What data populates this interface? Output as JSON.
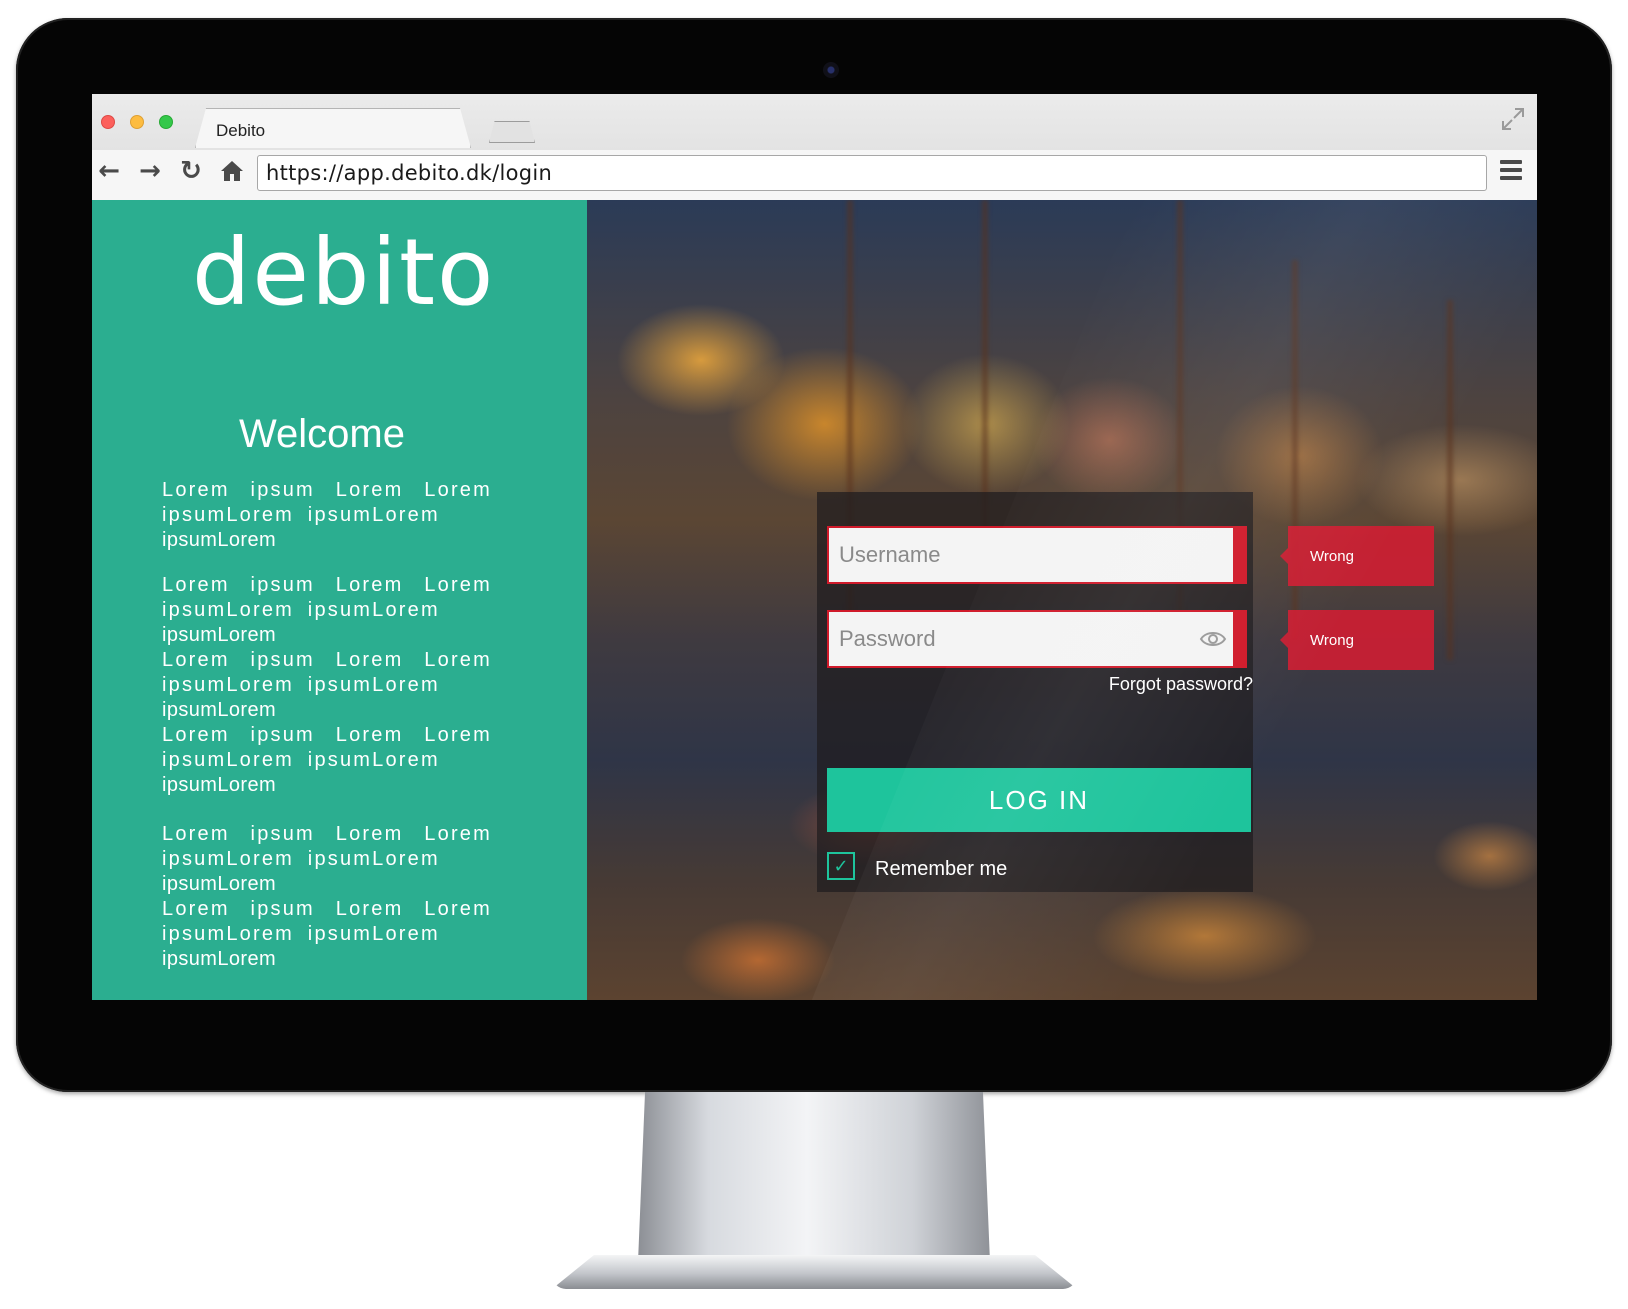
{
  "browser": {
    "tab_title": "Debito",
    "url": "https://app.debito.dk/login"
  },
  "left_panel": {
    "logo_text": "debito",
    "welcome": "Welcome",
    "paragraphs": [
      [
        "Lorem ipsum Lorem Lorem ipsumLorem ipsumLorem",
        "ipsumLorem"
      ],
      [
        "Lorem ipsum Lorem Lorem ipsumLorem ipsumLorem",
        "ipsumLorem"
      ],
      [
        "Lorem ipsum Lorem Lorem ipsumLorem ipsumLorem",
        "ipsumLorem"
      ],
      [
        "Lorem ipsum Lorem Lorem ipsumLorem ipsumLorem",
        "ipsumLorem"
      ],
      [
        "Lorem ipsum Lorem Lorem ipsumLorem ipsumLorem",
        "ipsumLorem"
      ],
      [
        "Lorem ipsum Lorem Lorem ipsumLorem ipsumLorem",
        "ipsumLorem"
      ]
    ],
    "background_color": "#2bae90"
  },
  "login": {
    "username_placeholder": "Username",
    "password_placeholder": "Password",
    "forgot_password": "Forgot password?",
    "login_button": "LOG IN",
    "remember_me": "Remember me",
    "remember_checked": true,
    "username_error": "Wrong",
    "password_error": "Wrong",
    "accent_color": "#1ec49c",
    "error_color": "#d01a2a"
  },
  "icons": {
    "back": "back-arrow-icon",
    "forward": "forward-arrow-icon",
    "reload": "reload-icon",
    "home": "home-icon",
    "menu": "hamburger-menu-icon",
    "eye": "eye-icon",
    "check": "checkmark-icon"
  }
}
